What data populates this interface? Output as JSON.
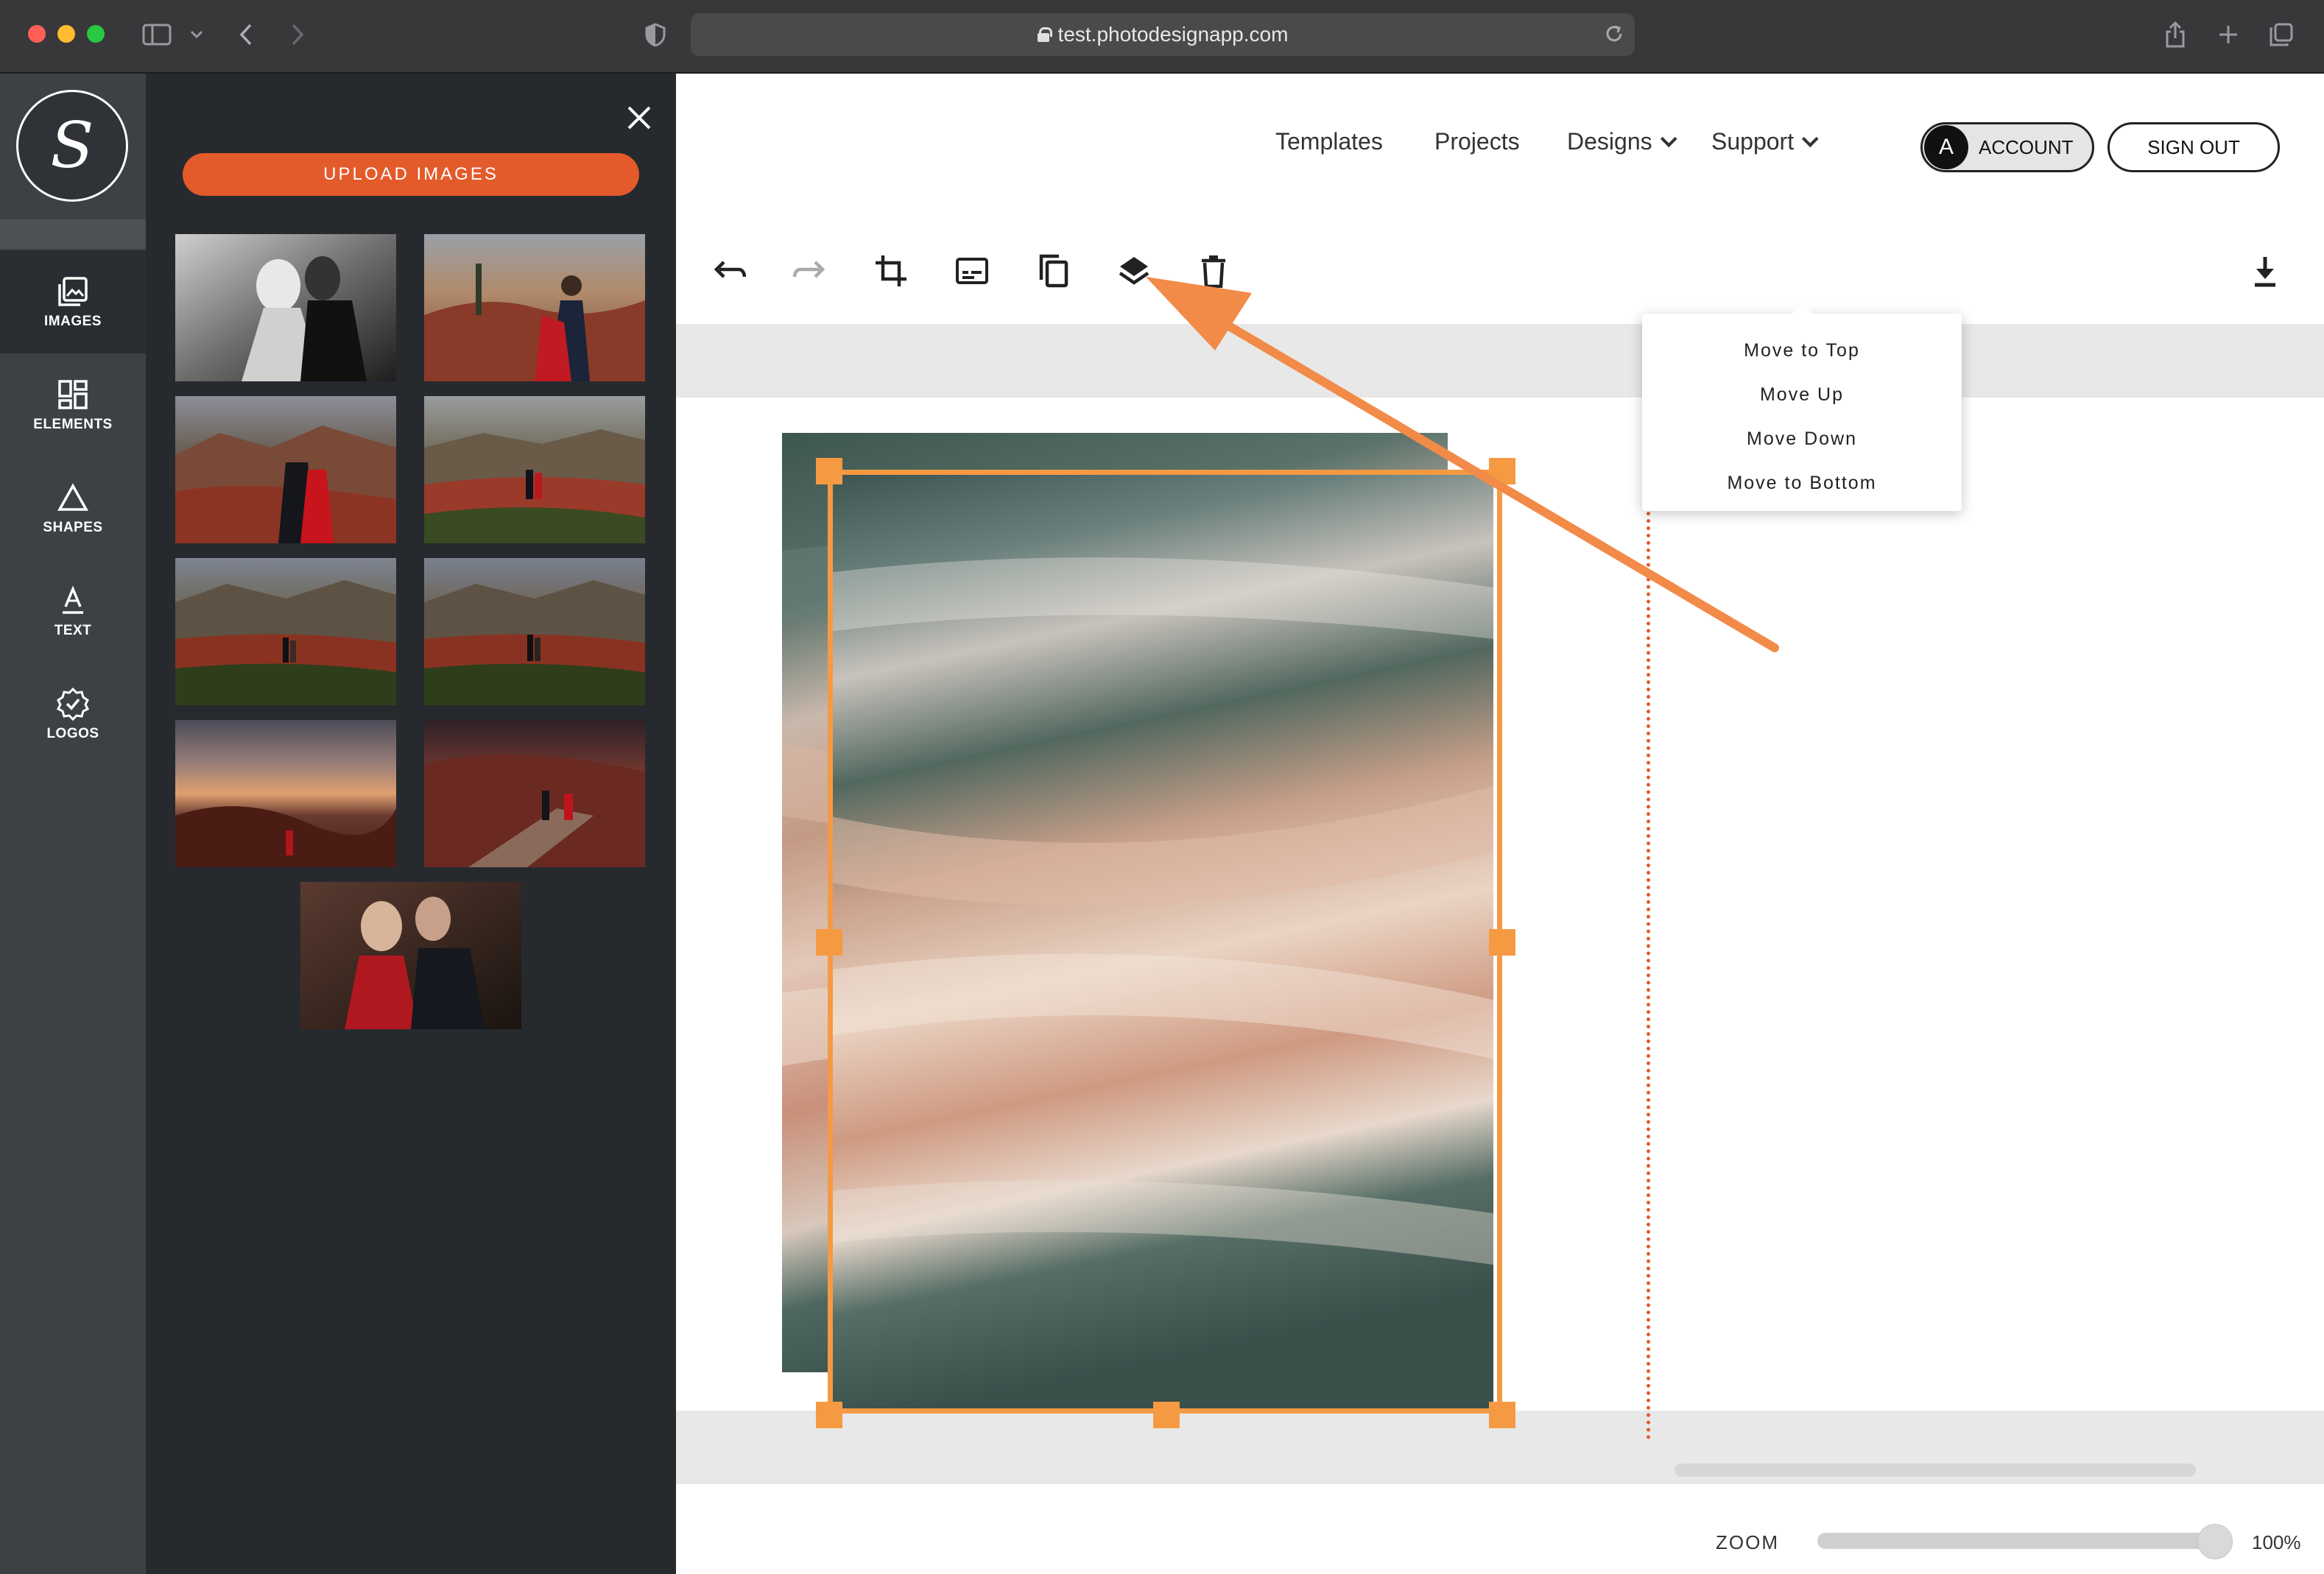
{
  "browser": {
    "url": "test.photodesignapp.com"
  },
  "rail": {
    "logo": "S",
    "items": [
      {
        "label": "IMAGES",
        "icon": "image-icon",
        "active": true
      },
      {
        "label": "ELEMENTS",
        "icon": "elements-icon",
        "active": false
      },
      {
        "label": "SHAPES",
        "icon": "triangle-icon",
        "active": false
      },
      {
        "label": "TEXT",
        "icon": "text-icon",
        "active": false
      },
      {
        "label": "LOGOS",
        "icon": "badge-icon",
        "active": false
      }
    ]
  },
  "panel": {
    "upload_label": "UPLOAD IMAGES",
    "close_icon": "close-icon",
    "thumbnail_count": 9
  },
  "header": {
    "nav": [
      {
        "label": "Templates"
      },
      {
        "label": "Projects"
      },
      {
        "label": "Designs",
        "dropdown": true
      },
      {
        "label": "Support",
        "dropdown": true
      }
    ],
    "account_initial": "A",
    "account_label": "ACCOUNT",
    "signout_label": "SIGN OUT"
  },
  "toolbar": {
    "tools": [
      "undo-icon",
      "redo-icon",
      "crop-icon",
      "caption-icon",
      "duplicate-icon",
      "layers-icon",
      "delete-icon",
      "download-icon"
    ]
  },
  "layers_menu": {
    "items": [
      {
        "label": "Move to Top"
      },
      {
        "label": "Move Up"
      },
      {
        "label": "Move Down"
      },
      {
        "label": "Move to Bottom"
      }
    ]
  },
  "zoom": {
    "label": "ZOOM",
    "value_text": "100%",
    "level": 1.0
  },
  "colors": {
    "accent": "#e35a2b",
    "selection": "#f59a43",
    "rail_bg": "#3d4145",
    "panel_bg": "#262a2e"
  }
}
